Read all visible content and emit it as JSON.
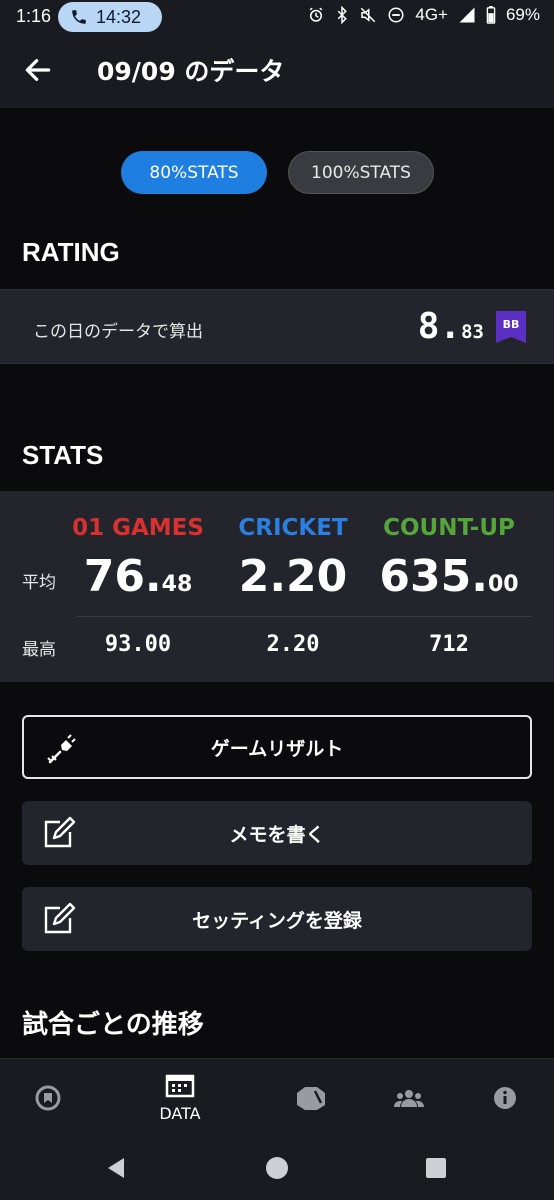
{
  "status_bar": {
    "time": "1:16",
    "call_time": "14:32",
    "network": "4G+",
    "battery": "69%"
  },
  "app_bar": {
    "title": "09/09 のデータ"
  },
  "toggle": {
    "option_80": "80%STATS",
    "option_100": "100%STATS",
    "selected": "80%STATS"
  },
  "rating": {
    "heading": "RATING",
    "label": "この日のデータで算出",
    "value_int": "8.",
    "value_dec": "83",
    "badge": "BB"
  },
  "stats": {
    "heading": "STATS",
    "row_avg_label": "平均",
    "row_max_label": "最高",
    "columns": [
      {
        "name": "01 GAMES",
        "color": "#d9312f",
        "avg_int": "76.",
        "avg_dec": "48",
        "max": "93.00"
      },
      {
        "name": "CRICKET",
        "color": "#2a7fe0",
        "avg_int": "2.20",
        "avg_dec": "",
        "max": "2.20"
      },
      {
        "name": "COUNT-UP",
        "color": "#55a63a",
        "avg_int": "635.",
        "avg_dec": "00",
        "max": "712"
      }
    ]
  },
  "actions": {
    "game_result": "ゲームリザルト",
    "write_memo": "メモを書く",
    "register_setting": "セッティングを登録"
  },
  "trend": {
    "heading": "試合ごとの推移"
  },
  "bottom_nav": {
    "data_label": "DATA"
  },
  "colors": {
    "accent": "#1e7fe0",
    "badge": "#5a2fc2"
  }
}
